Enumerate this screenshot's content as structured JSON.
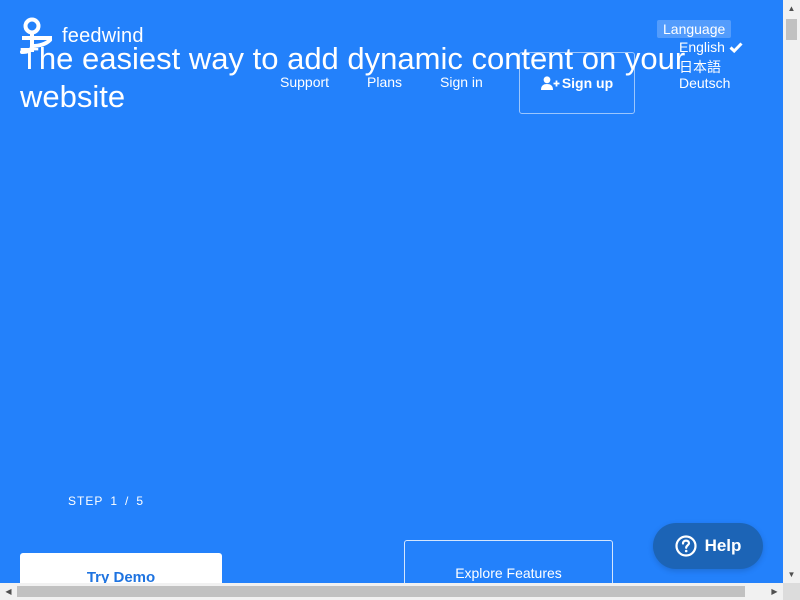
{
  "brand": {
    "name": "feedwind"
  },
  "hero": {
    "title": "The easiest way to add dynamic content on your website"
  },
  "nav": {
    "support": "Support",
    "plans": "Plans",
    "sign_in": "Sign in",
    "sign_up": "Sign up"
  },
  "language": {
    "label": "Language",
    "options": [
      "English",
      "日本語",
      "Deutsch"
    ],
    "selected": "English"
  },
  "steps": {
    "label": "STEP",
    "current": "1",
    "separator": "/",
    "total": "5"
  },
  "actions": {
    "try_demo": "Try Demo",
    "explore_features": "Explore Features"
  },
  "help": {
    "label": "Help"
  },
  "colors": {
    "background": "#2381fb",
    "help_button": "#1c64b6",
    "text": "#ffffff"
  }
}
